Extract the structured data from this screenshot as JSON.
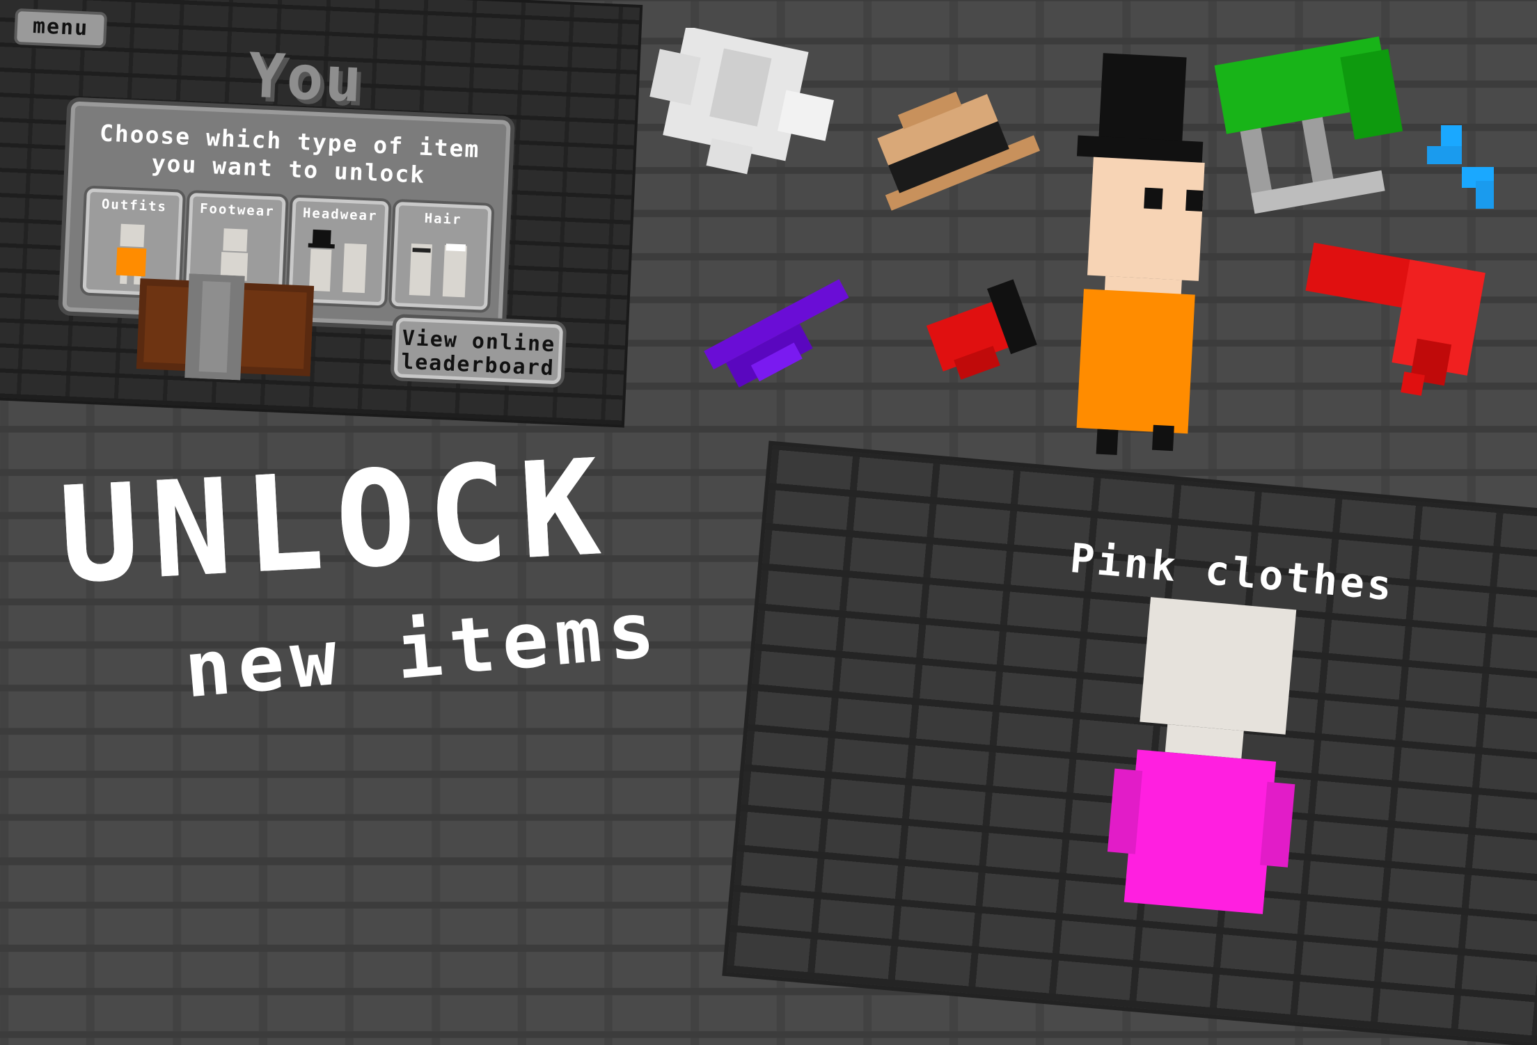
{
  "win_screen": {
    "menu_label": "menu",
    "title": "You Win!",
    "prompt_line1": "Choose which type of item",
    "prompt_line2": "you want to unlock",
    "categories": [
      {
        "label": "Outfits"
      },
      {
        "label": "Footwear"
      },
      {
        "label": "Headwear"
      },
      {
        "label": "Hair"
      }
    ],
    "leaderboard_line1": "View online",
    "leaderboard_line2": "leaderboard"
  },
  "headline": {
    "title": "UNLOCK",
    "subtitle": "new items"
  },
  "preview": {
    "label": "Pink clothes"
  },
  "colors": {
    "outfit_orange": "#ff8c00",
    "pink_clothes": "#ff1fe0",
    "hat_green": "#18b418",
    "purple_item": "#6a0dd6",
    "red_item": "#e01010"
  }
}
